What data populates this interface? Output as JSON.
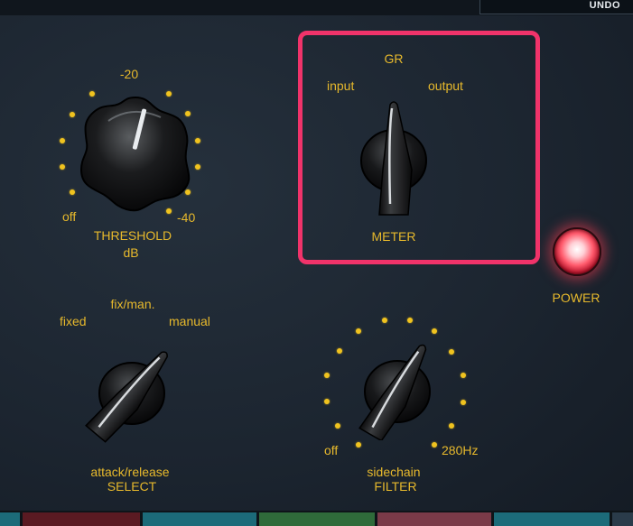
{
  "toolbar": {
    "undo_label": "UNDO"
  },
  "threshold": {
    "top_label": "-20",
    "off_label": "off",
    "max_label": "-40",
    "name": "THRESHOLD",
    "unit": "dB"
  },
  "meter": {
    "gr_label": "GR",
    "input_label": "input",
    "output_label": "output",
    "name": "METER",
    "selected": "GR"
  },
  "power": {
    "label": "POWER",
    "state": "on"
  },
  "attack_release": {
    "fixed_label": "fixed",
    "fixman_label": "fix/man.",
    "manual_label": "manual",
    "name_line1": "attack/release",
    "name_line2": "SELECT"
  },
  "sidechain": {
    "off_label": "off",
    "max_label": "280Hz",
    "name_line1": "sidechain",
    "name_line2": "FILTER"
  },
  "colors": {
    "label": "#e7b92c",
    "highlight": "#f0336a",
    "power_led": "#ff5a6c",
    "panel": "#1d2631"
  }
}
